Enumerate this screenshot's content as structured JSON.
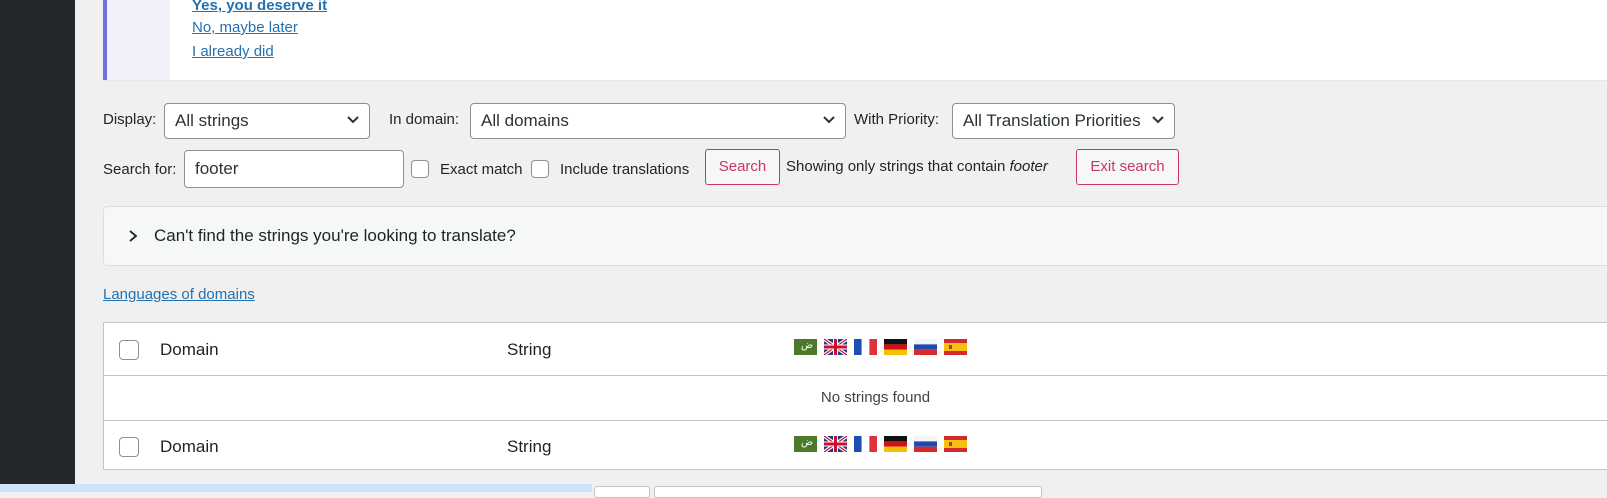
{
  "notice": {
    "links": [
      "Yes, you deserve it",
      "No, maybe later",
      "I already did"
    ]
  },
  "filters": {
    "display_label": "Display:",
    "display_value": "All strings",
    "domain_label": "In domain:",
    "domain_value": "All domains",
    "priority_label": "With Priority:",
    "priority_value": "All Translation Priorities",
    "search_label": "Search for:",
    "search_value": "footer",
    "exact_match_label": "Exact match",
    "include_translations_label": "Include translations",
    "search_button": "Search",
    "showing_prefix": "Showing only strings that contain",
    "showing_term": "footer",
    "exit_search_button": "Exit search"
  },
  "help_box": {
    "text": "Can't find the strings you're looking to translate?"
  },
  "languages_link": "Languages of domains",
  "table": {
    "columns": [
      "Domain",
      "String"
    ],
    "language_flags": [
      "arabic-flag",
      "uk-flag",
      "france-flag",
      "germany-flag",
      "russia-flag",
      "spain-flag"
    ],
    "empty_message": "No strings found"
  },
  "colors": {
    "accent": "#c9356e",
    "link": "#2271b1",
    "notice_border": "#7272d6",
    "sidebar": "#23282d"
  }
}
